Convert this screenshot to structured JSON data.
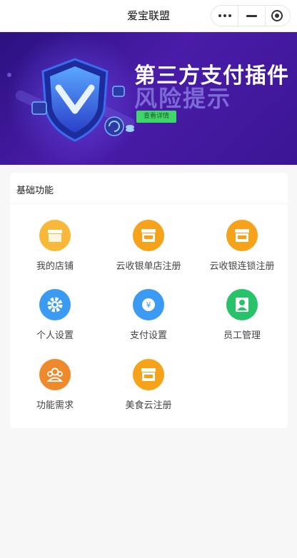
{
  "header": {
    "title": "爱宝联盟",
    "more_icon": "more-dots-icon",
    "minimize_icon": "minimize-icon",
    "close_icon": "target-close-icon"
  },
  "banner": {
    "title": "第三方支付插件",
    "subtitle": "风险提示",
    "button_label": "查看详情"
  },
  "section": {
    "title": "基础功能"
  },
  "items": [
    {
      "label": "我的店铺",
      "icon": "store-icon",
      "color": "#f7b733"
    },
    {
      "label": "云收银单店注册",
      "icon": "register-store-icon",
      "color": "#f7a21b"
    },
    {
      "label": "云收银连锁注册",
      "icon": "register-chain-icon",
      "color": "#f7a21b"
    },
    {
      "label": "个人设置",
      "icon": "gear-icon",
      "color": "#3b9bf2"
    },
    {
      "label": "支付设置",
      "icon": "yen-icon",
      "color": "#3b9bf2"
    },
    {
      "label": "员工管理",
      "icon": "person-icon",
      "color": "#28c26b"
    },
    {
      "label": "功能需求",
      "icon": "users-icon",
      "color": "#ef8a2c"
    },
    {
      "label": "美食云注册",
      "icon": "register-food-icon",
      "color": "#f7a21b"
    }
  ]
}
